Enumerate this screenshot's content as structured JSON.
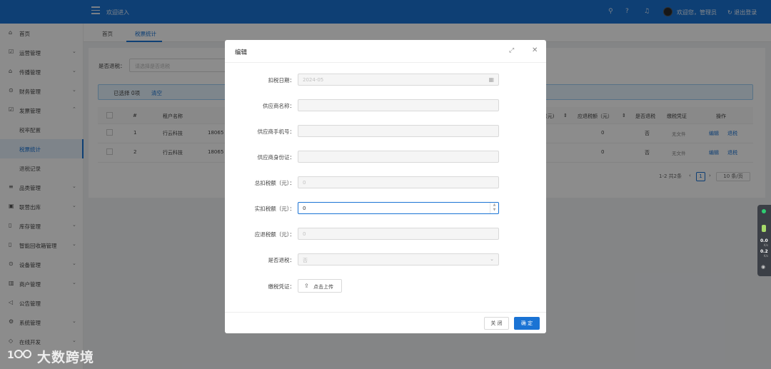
{
  "header": {
    "welcome": "欢迎进入",
    "user_text": "欢迎您，管理员",
    "logout": "退出登录",
    "icons": [
      "search-icon",
      "help-icon",
      "bell-icon"
    ]
  },
  "sidebar": {
    "items": [
      {
        "label": "首页",
        "icon": "⌂"
      },
      {
        "label": "运营管理",
        "icon": "☑",
        "arrow": "⌄"
      },
      {
        "label": "传播管理",
        "icon": "⌂",
        "arrow": "⌄"
      },
      {
        "label": "财务管理",
        "icon": "⊙",
        "arrow": "⌄"
      },
      {
        "label": "发票管理",
        "icon": "☑",
        "arrow": "⌃"
      },
      {
        "label": "税率配置"
      },
      {
        "label": "税票统计"
      },
      {
        "label": "退税记录"
      },
      {
        "label": "品类管理",
        "icon": "≡",
        "arrow": "⌄"
      },
      {
        "label": "联营出库",
        "icon": "▣",
        "arrow": "⌄"
      },
      {
        "label": "库存管理",
        "icon": "▯",
        "arrow": "⌄"
      },
      {
        "label": "智能回收箱管理",
        "icon": "▯",
        "arrow": "⌄"
      },
      {
        "label": "设备管理",
        "icon": "⊙",
        "arrow": "⌄"
      },
      {
        "label": "商户管理",
        "icon": "▥",
        "arrow": "⌄"
      },
      {
        "label": "公告管理",
        "icon": "◁",
        "arrow": ""
      },
      {
        "label": "系统管理",
        "icon": "⚙",
        "arrow": "⌄"
      },
      {
        "label": "在线开发",
        "icon": "◇",
        "arrow": "⌄"
      }
    ]
  },
  "tabs": [
    {
      "label": "首页"
    },
    {
      "label": "税票统计"
    }
  ],
  "filter": {
    "label": "是否退税：",
    "placeholder": "请选择是否退税"
  },
  "selection": {
    "text": "已选择 0项",
    "clear": "清空"
  },
  "table": {
    "headers": {
      "index": "#",
      "tenant": "租户名称",
      "actual_col_tail": "(元)",
      "refund_amount": "应退税额（元）",
      "is_refund": "是否退税",
      "proof": "缴税凭证",
      "action": "操作"
    },
    "rows": [
      {
        "index": "1",
        "tenant": "行云科技",
        "phone": "18065",
        "refund": "0",
        "is_refund": "否",
        "proof": "无文件",
        "edit": "编辑",
        "refund_btn": "退税"
      },
      {
        "index": "2",
        "tenant": "行云科技",
        "phone": "18065",
        "refund": "0",
        "is_refund": "否",
        "proof": "无文件",
        "edit": "编辑",
        "refund_btn": "退税"
      }
    ]
  },
  "pagination": {
    "summary": "1-2 共2条",
    "current": "1",
    "page_size": "10 条/页"
  },
  "modal": {
    "title": "编辑",
    "fields": {
      "tax_date_label": "扣税日期：",
      "tax_date_value": "2024-05",
      "supplier_name_label": "供应商名称：",
      "supplier_name_value": "",
      "supplier_phone_label": "供应商手机号：",
      "supplier_phone_value": "",
      "supplier_id_label": "供应商身份证：",
      "supplier_id_value": "",
      "total_tax_label": "总扣税额（元）：",
      "total_tax_value": "0",
      "actual_tax_label": "实扣税额（元）：",
      "actual_tax_value": "0",
      "refund_tax_label": "应退税额（元）：",
      "refund_tax_value": "0",
      "is_refund_label": "是否退税：",
      "is_refund_value": "否",
      "proof_label": "缴税凭证：",
      "upload_label": "点击上传"
    },
    "cancel": "关 闭",
    "ok": "确 定"
  },
  "float_widget": {
    "up": "0.0",
    "down": "0.2",
    "unit": "K/s"
  },
  "watermark": {
    "text": "大数跨境",
    "logo": "100"
  }
}
